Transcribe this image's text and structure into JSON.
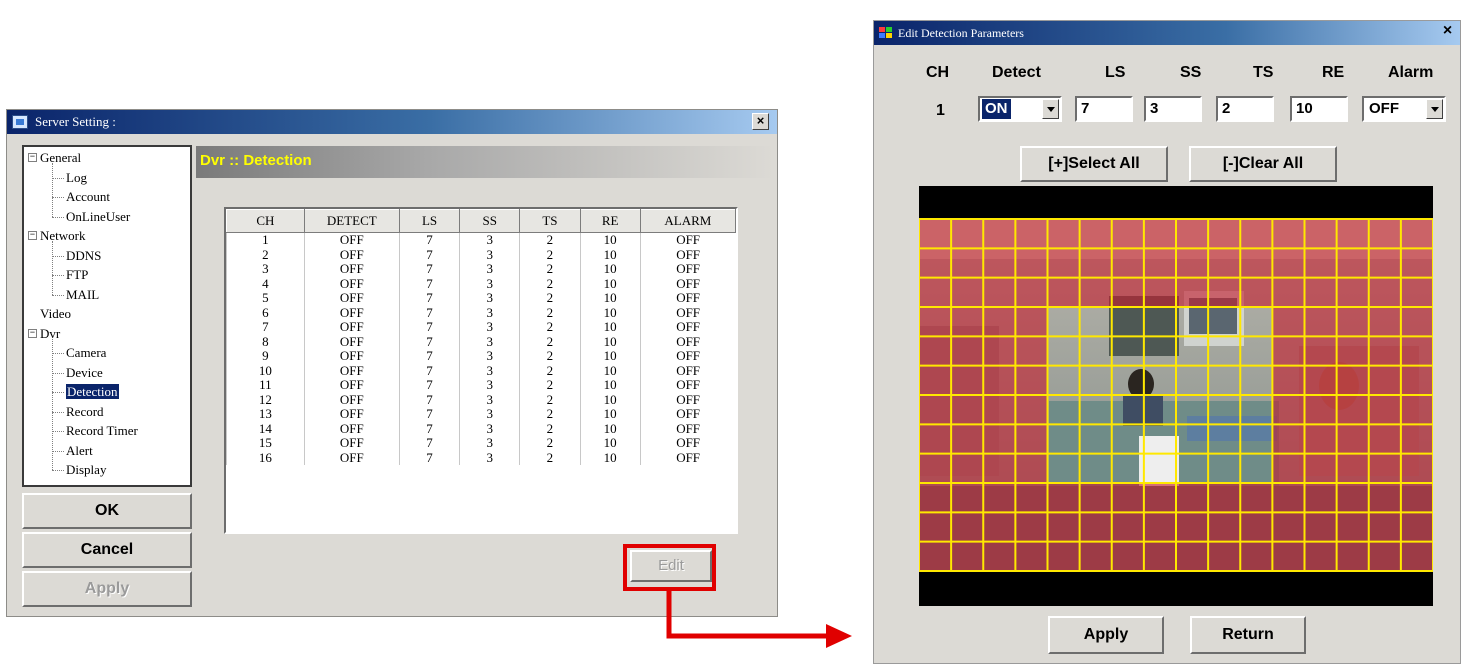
{
  "server_window": {
    "title": "Server Setting :",
    "close": "×",
    "header": "Dvr :: Detection",
    "tree": [
      {
        "label": "General",
        "level": 0,
        "expander": "−"
      },
      {
        "label": "Log",
        "level": 1
      },
      {
        "label": "Account",
        "level": 1
      },
      {
        "label": "OnLineUser",
        "level": 1
      },
      {
        "label": "Network",
        "level": 0,
        "expander": "−"
      },
      {
        "label": "DDNS",
        "level": 1
      },
      {
        "label": "FTP",
        "level": 1
      },
      {
        "label": "MAIL",
        "level": 1
      },
      {
        "label": "Video",
        "level": 0
      },
      {
        "label": "Dvr",
        "level": 0,
        "expander": "−"
      },
      {
        "label": "Camera",
        "level": 1
      },
      {
        "label": "Device",
        "level": 1
      },
      {
        "label": "Detection",
        "level": 1,
        "selected": true
      },
      {
        "label": "Record",
        "level": 1
      },
      {
        "label": "Record Timer",
        "level": 1
      },
      {
        "label": "Alert",
        "level": 1
      },
      {
        "label": "Display",
        "level": 1
      }
    ],
    "buttons": {
      "ok": "OK",
      "cancel": "Cancel",
      "apply": "Apply",
      "edit": "Edit"
    },
    "table": {
      "columns": [
        "CH",
        "DETECT",
        "LS",
        "SS",
        "TS",
        "RE",
        "ALARM"
      ],
      "rows": [
        [
          "1",
          "OFF",
          "7",
          "3",
          "2",
          "10",
          "OFF"
        ],
        [
          "2",
          "OFF",
          "7",
          "3",
          "2",
          "10",
          "OFF"
        ],
        [
          "3",
          "OFF",
          "7",
          "3",
          "2",
          "10",
          "OFF"
        ],
        [
          "4",
          "OFF",
          "7",
          "3",
          "2",
          "10",
          "OFF"
        ],
        [
          "5",
          "OFF",
          "7",
          "3",
          "2",
          "10",
          "OFF"
        ],
        [
          "6",
          "OFF",
          "7",
          "3",
          "2",
          "10",
          "OFF"
        ],
        [
          "7",
          "OFF",
          "7",
          "3",
          "2",
          "10",
          "OFF"
        ],
        [
          "8",
          "OFF",
          "7",
          "3",
          "2",
          "10",
          "OFF"
        ],
        [
          "9",
          "OFF",
          "7",
          "3",
          "2",
          "10",
          "OFF"
        ],
        [
          "10",
          "OFF",
          "7",
          "3",
          "2",
          "10",
          "OFF"
        ],
        [
          "11",
          "OFF",
          "7",
          "3",
          "2",
          "10",
          "OFF"
        ],
        [
          "12",
          "OFF",
          "7",
          "3",
          "2",
          "10",
          "OFF"
        ],
        [
          "13",
          "OFF",
          "7",
          "3",
          "2",
          "10",
          "OFF"
        ],
        [
          "14",
          "OFF",
          "7",
          "3",
          "2",
          "10",
          "OFF"
        ],
        [
          "15",
          "OFF",
          "7",
          "3",
          "2",
          "10",
          "OFF"
        ],
        [
          "16",
          "OFF",
          "7",
          "3",
          "2",
          "10",
          "OFF"
        ]
      ]
    }
  },
  "detection_window": {
    "title": "Edit Detection Parameters",
    "close": "×",
    "labels": {
      "ch": "CH",
      "detect": "Detect",
      "ls": "LS",
      "ss": "SS",
      "ts": "TS",
      "re": "RE",
      "alarm": "Alarm"
    },
    "values": {
      "ch": "1",
      "detect": "ON",
      "ls": "7",
      "ss": "3",
      "ts": "2",
      "re": "10",
      "alarm": "OFF"
    },
    "buttons": {
      "select_all": "[+]Select All",
      "clear_all": "[-]Clear All",
      "apply": "Apply",
      "return": "Return"
    },
    "grid": {
      "cols": 16,
      "rows": 12
    },
    "colors": {
      "selected_cell": "#c41e2e",
      "grid_line": "#ffe800",
      "arrow": "#e00000"
    }
  }
}
